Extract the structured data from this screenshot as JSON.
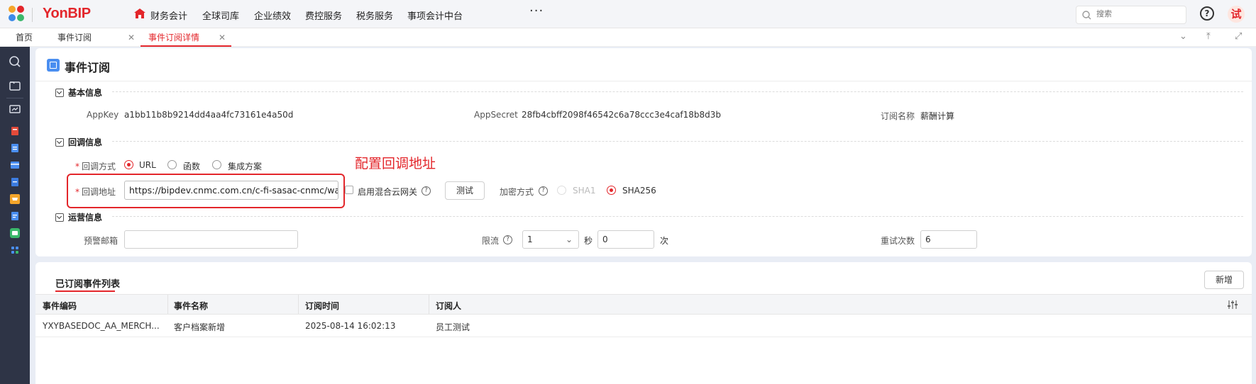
{
  "app": {
    "brand": "YonBIP",
    "nav": [
      "财务会计",
      "全球司库",
      "企业绩效",
      "费控服务",
      "税务服务",
      "事项会计中台"
    ],
    "more": "···",
    "search_placeholder": "搜索",
    "help": "?",
    "avatar": "试"
  },
  "tabs": [
    {
      "label": "首页"
    },
    {
      "label": "事件订阅"
    },
    {
      "label": "事件订阅详情"
    }
  ],
  "page": {
    "title": "事件订阅",
    "sections": {
      "basic": "基本信息",
      "callback": "回调信息",
      "ops": "运营信息"
    },
    "basic": {
      "appkey_label": "AppKey",
      "appkey": "a1bb11b8b9214dd4aa4fc73161e4a50d",
      "appsecret_label": "AppSecret",
      "appsecret": "28fb4cbff2098f46542c6a78ccc3e4caf18b8d3b",
      "subname_label": "订阅名称",
      "subname": "薪酬计算"
    },
    "callback": {
      "method_label": "回调方式",
      "methods": [
        "URL",
        "函数",
        "集成方案"
      ],
      "method_selected": "URL",
      "url_label": "回调地址",
      "url": "https://bipdev.cnmc.com.cn/c-fi-sasac-cnmc/wap",
      "hybrid_label": "启用混合云网关",
      "test_button": "测试",
      "encrypt_label": "加密方式",
      "encrypt_options": [
        "SHA1",
        "SHA256"
      ],
      "encrypt_selected": "SHA256",
      "annotation": "配置回调地址"
    },
    "ops": {
      "email_label": "预警邮箱",
      "email": "",
      "rate_label": "限流",
      "rate_value": "1",
      "sec_label": "秒",
      "sec_value": "0",
      "times_label": "次",
      "retry_label": "重试次数",
      "retry_value": "6"
    }
  },
  "list": {
    "tab": "已订阅事件列表",
    "add_button": "新增",
    "columns": [
      "事件编码",
      "事件名称",
      "订阅时间",
      "订阅人"
    ],
    "rows": [
      [
        "YXYBASEDOC_AA_MERCH...",
        "客户档案新增",
        "2025-08-14 16:02:13",
        "员工测试"
      ]
    ]
  },
  "colors": {
    "accent": "#e3262b",
    "sidebar": "#2e3446",
    "primary_icon": "#4a8ef0"
  }
}
